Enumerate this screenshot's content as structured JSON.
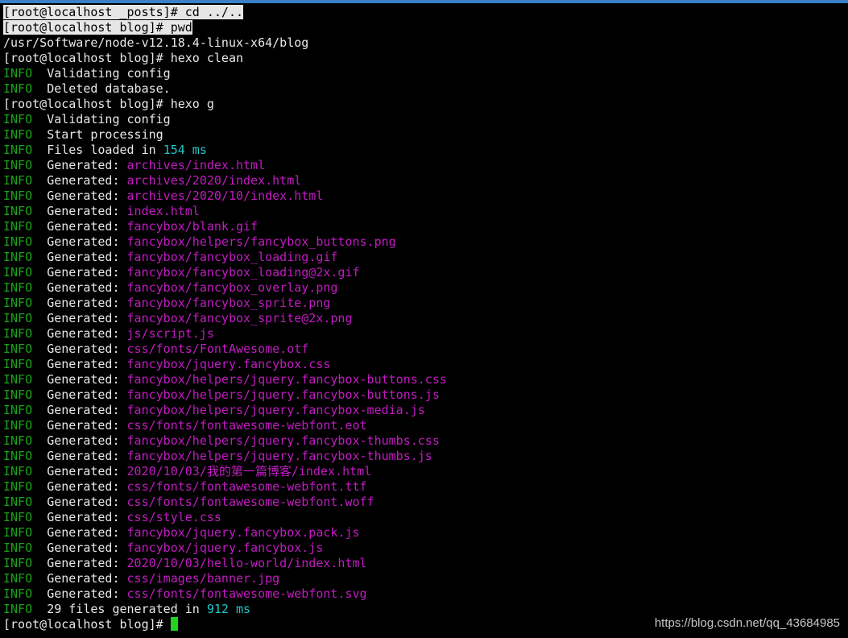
{
  "colors": {
    "background": "#000000",
    "text": "#e8e8e8",
    "info": "#19a319",
    "path": "#c21bc2",
    "number": "#1ec8c8",
    "cursor": "#21d321",
    "titlebar_accent": "#3d7fc6"
  },
  "lines": [
    {
      "type": "cmd",
      "selected": true,
      "text": "[root@localhost _posts]# cd ../.."
    },
    {
      "type": "cmd",
      "selected": true,
      "text": "[root@localhost blog]# pwd"
    },
    {
      "type": "plain",
      "text": "/usr/Software/node-v12.18.4-linux-x64/blog"
    },
    {
      "type": "cmd",
      "text": "[root@localhost blog]# hexo clean"
    },
    {
      "type": "info",
      "level": "INFO",
      "msg": "Validating config"
    },
    {
      "type": "info",
      "level": "INFO",
      "msg": "Deleted database."
    },
    {
      "type": "cmd",
      "text": "[root@localhost blog]# hexo g"
    },
    {
      "type": "info",
      "level": "INFO",
      "msg": "Validating config"
    },
    {
      "type": "info",
      "level": "INFO",
      "msg": "Start processing"
    },
    {
      "type": "info-num",
      "level": "INFO",
      "pre": "Files loaded in ",
      "num": "154 ms"
    },
    {
      "type": "gen",
      "level": "INFO",
      "label": "Generated: ",
      "path": "archives/index.html"
    },
    {
      "type": "gen",
      "level": "INFO",
      "label": "Generated: ",
      "path": "archives/2020/index.html"
    },
    {
      "type": "gen",
      "level": "INFO",
      "label": "Generated: ",
      "path": "archives/2020/10/index.html"
    },
    {
      "type": "gen",
      "level": "INFO",
      "label": "Generated: ",
      "path": "index.html"
    },
    {
      "type": "gen",
      "level": "INFO",
      "label": "Generated: ",
      "path": "fancybox/blank.gif"
    },
    {
      "type": "gen",
      "level": "INFO",
      "label": "Generated: ",
      "path": "fancybox/helpers/fancybox_buttons.png"
    },
    {
      "type": "gen",
      "level": "INFO",
      "label": "Generated: ",
      "path": "fancybox/fancybox_loading.gif"
    },
    {
      "type": "gen",
      "level": "INFO",
      "label": "Generated: ",
      "path": "fancybox/fancybox_loading@2x.gif"
    },
    {
      "type": "gen",
      "level": "INFO",
      "label": "Generated: ",
      "path": "fancybox/fancybox_overlay.png"
    },
    {
      "type": "gen",
      "level": "INFO",
      "label": "Generated: ",
      "path": "fancybox/fancybox_sprite.png"
    },
    {
      "type": "gen",
      "level": "INFO",
      "label": "Generated: ",
      "path": "fancybox/fancybox_sprite@2x.png"
    },
    {
      "type": "gen",
      "level": "INFO",
      "label": "Generated: ",
      "path": "js/script.js"
    },
    {
      "type": "gen",
      "level": "INFO",
      "label": "Generated: ",
      "path": "css/fonts/FontAwesome.otf"
    },
    {
      "type": "gen",
      "level": "INFO",
      "label": "Generated: ",
      "path": "fancybox/jquery.fancybox.css"
    },
    {
      "type": "gen",
      "level": "INFO",
      "label": "Generated: ",
      "path": "fancybox/helpers/jquery.fancybox-buttons.css"
    },
    {
      "type": "gen",
      "level": "INFO",
      "label": "Generated: ",
      "path": "fancybox/helpers/jquery.fancybox-buttons.js"
    },
    {
      "type": "gen",
      "level": "INFO",
      "label": "Generated: ",
      "path": "fancybox/helpers/jquery.fancybox-media.js"
    },
    {
      "type": "gen",
      "level": "INFO",
      "label": "Generated: ",
      "path": "css/fonts/fontawesome-webfont.eot"
    },
    {
      "type": "gen",
      "level": "INFO",
      "label": "Generated: ",
      "path": "fancybox/helpers/jquery.fancybox-thumbs.css"
    },
    {
      "type": "gen",
      "level": "INFO",
      "label": "Generated: ",
      "path": "fancybox/helpers/jquery.fancybox-thumbs.js"
    },
    {
      "type": "gen",
      "level": "INFO",
      "label": "Generated: ",
      "path": "2020/10/03/我的第一篇博客/index.html"
    },
    {
      "type": "gen",
      "level": "INFO",
      "label": "Generated: ",
      "path": "css/fonts/fontawesome-webfont.ttf"
    },
    {
      "type": "gen",
      "level": "INFO",
      "label": "Generated: ",
      "path": "css/fonts/fontawesome-webfont.woff"
    },
    {
      "type": "gen",
      "level": "INFO",
      "label": "Generated: ",
      "path": "css/style.css"
    },
    {
      "type": "gen",
      "level": "INFO",
      "label": "Generated: ",
      "path": "fancybox/jquery.fancybox.pack.js"
    },
    {
      "type": "gen",
      "level": "INFO",
      "label": "Generated: ",
      "path": "fancybox/jquery.fancybox.js"
    },
    {
      "type": "gen",
      "level": "INFO",
      "label": "Generated: ",
      "path": "2020/10/03/hello-world/index.html"
    },
    {
      "type": "gen",
      "level": "INFO",
      "label": "Generated: ",
      "path": "css/images/banner.jpg"
    },
    {
      "type": "gen",
      "level": "INFO",
      "label": "Generated: ",
      "path": "css/fonts/fontawesome-webfont.svg"
    },
    {
      "type": "info-num",
      "level": "INFO",
      "pre": "29 files generated in ",
      "num": "912 ms"
    },
    {
      "type": "prompt",
      "text": "[root@localhost blog]# "
    }
  ],
  "watermark": "https://blog.csdn.net/qq_43684985"
}
